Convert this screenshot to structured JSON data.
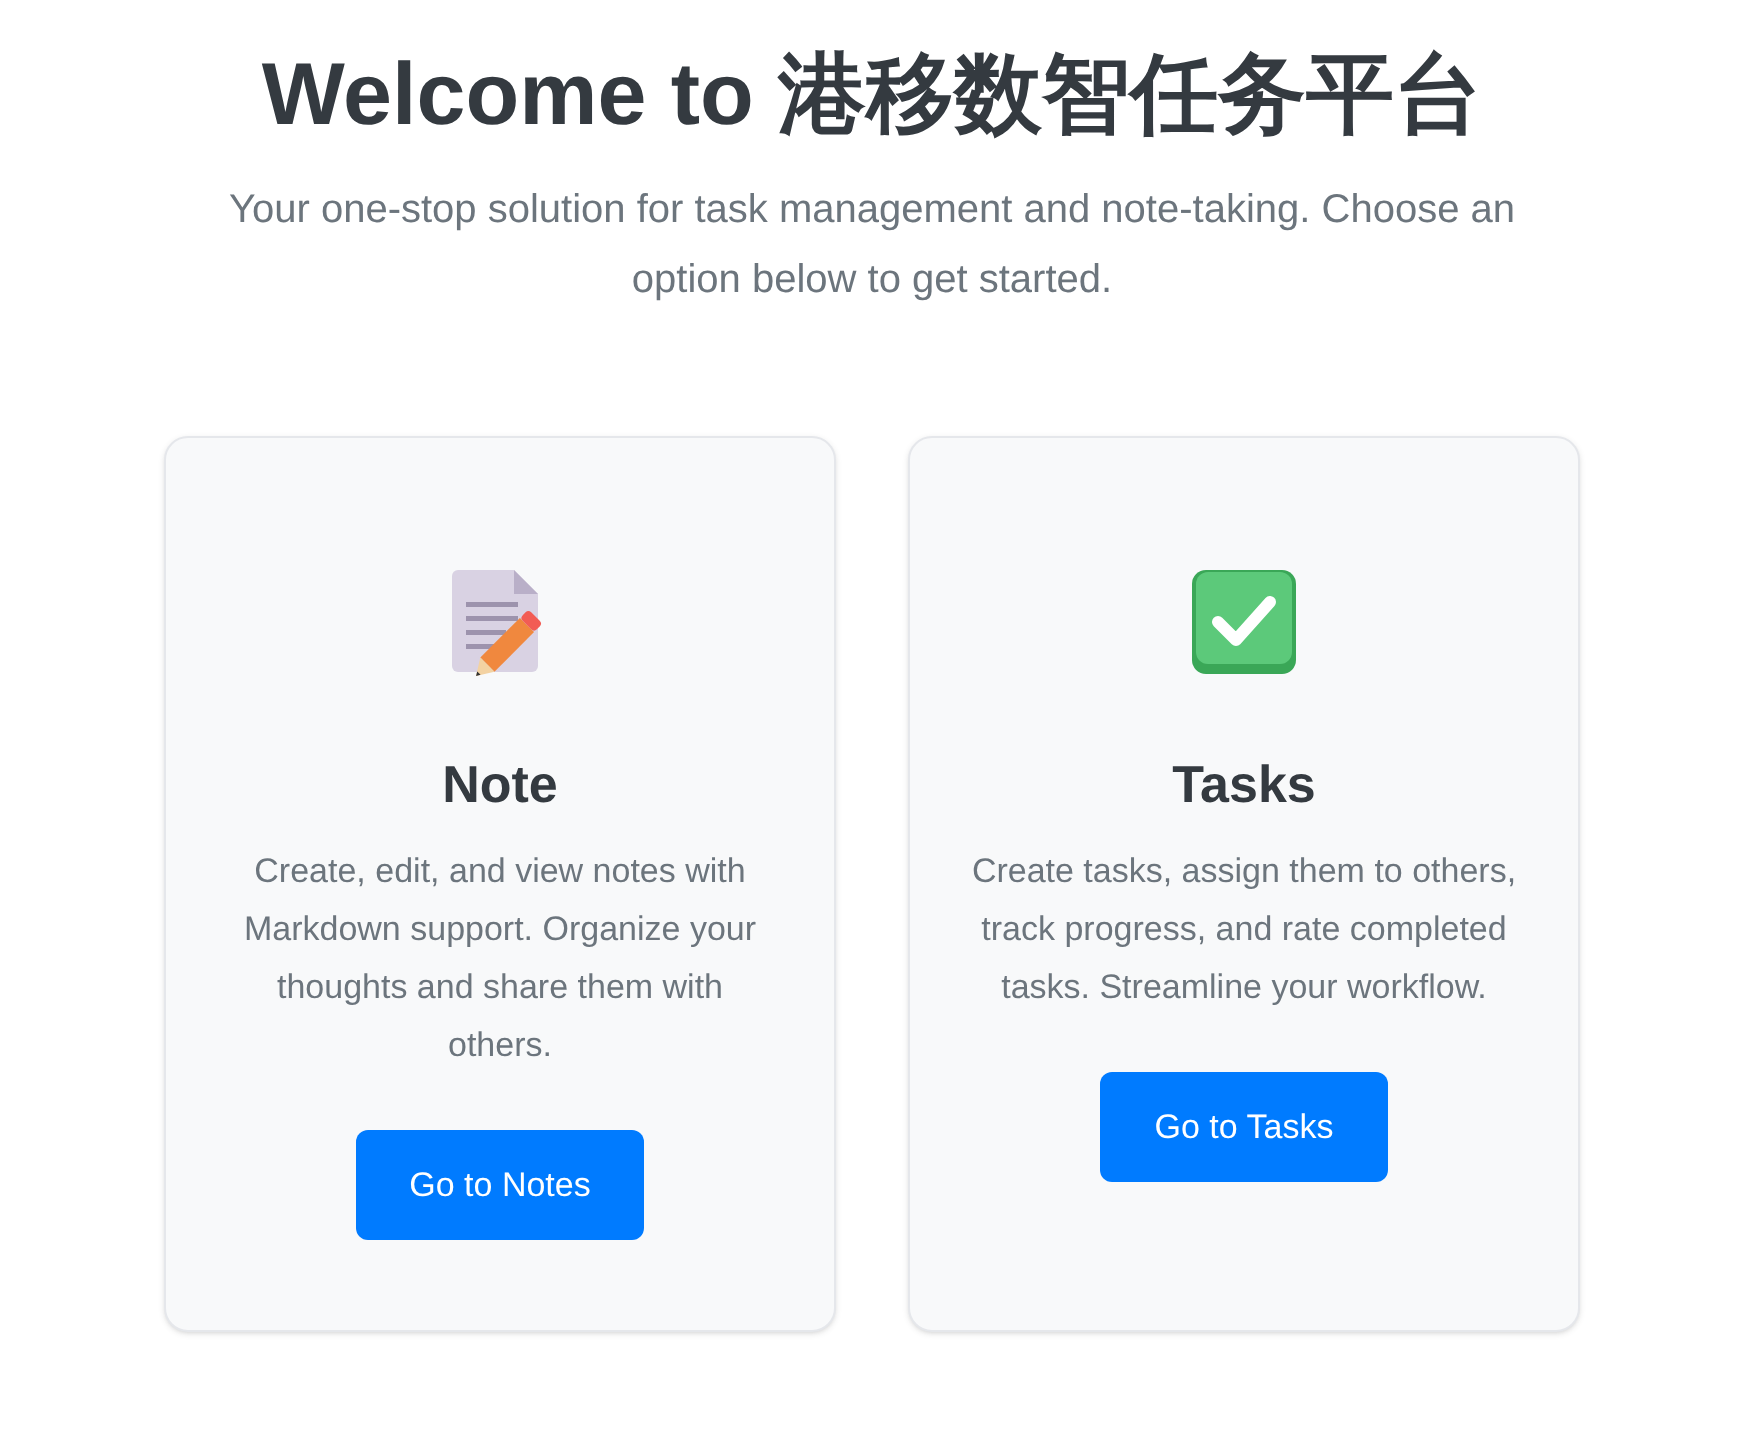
{
  "title": "Welcome to 港移数智任务平台",
  "subtitle": "Your one-stop solution for task management and note-taking. Choose an option below to get started.",
  "cards": [
    {
      "kind": "note",
      "title": "Note",
      "description": "Create, edit, and view notes with Markdown support. Organize your thoughts and share them with others.",
      "button": "Go to Notes"
    },
    {
      "kind": "tasks",
      "title": "Tasks",
      "description": "Create tasks, assign them to others, track progress, and rate completed tasks. Streamline your workflow.",
      "button": "Go to Tasks"
    }
  ]
}
